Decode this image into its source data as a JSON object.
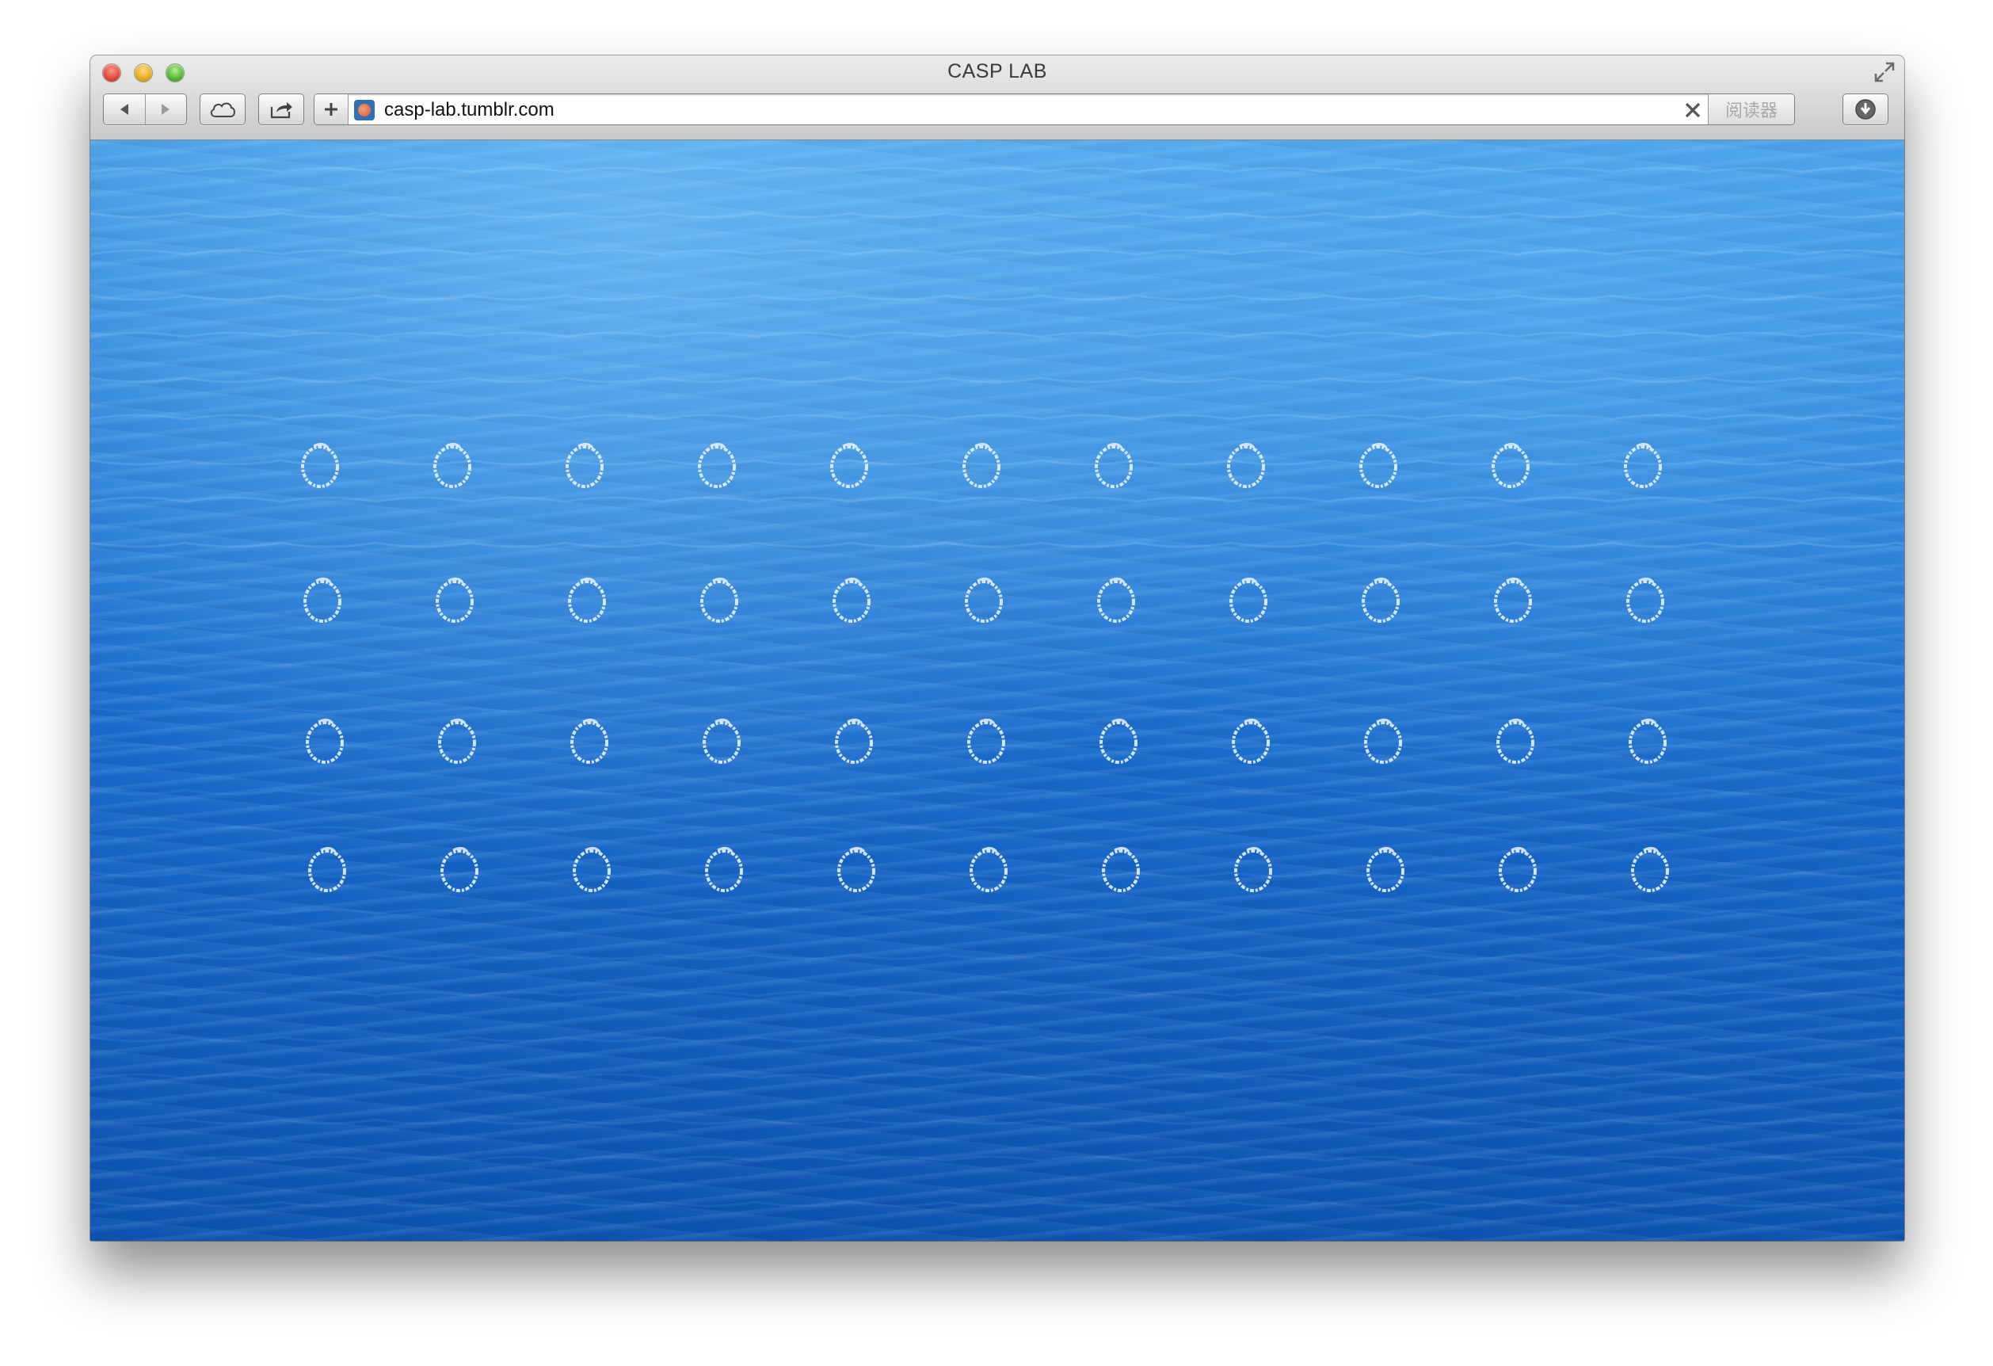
{
  "window": {
    "title": "CASP LAB"
  },
  "toolbar": {
    "back_icon": "back-arrow-icon",
    "forward_icon": "forward-arrow-icon",
    "icloud_icon": "cloud-icon",
    "share_icon": "share-icon",
    "add_icon": "plus-icon",
    "download_icon": "download-icon"
  },
  "address_bar": {
    "url": "casp-lab.tumblr.com",
    "reader_label": "阅读器",
    "stop_icon": "close-x-icon"
  },
  "page": {
    "background": "ocean-water-photo",
    "ring_rows": 4,
    "ring_columns": 11,
    "ring_icon": "chalk-circle-icon"
  },
  "colors": {
    "close": "#e0443a",
    "minimize": "#e6a91e",
    "zoom": "#4fb82e",
    "water": "#1a6fd0",
    "ring": "#e8f2ff"
  }
}
